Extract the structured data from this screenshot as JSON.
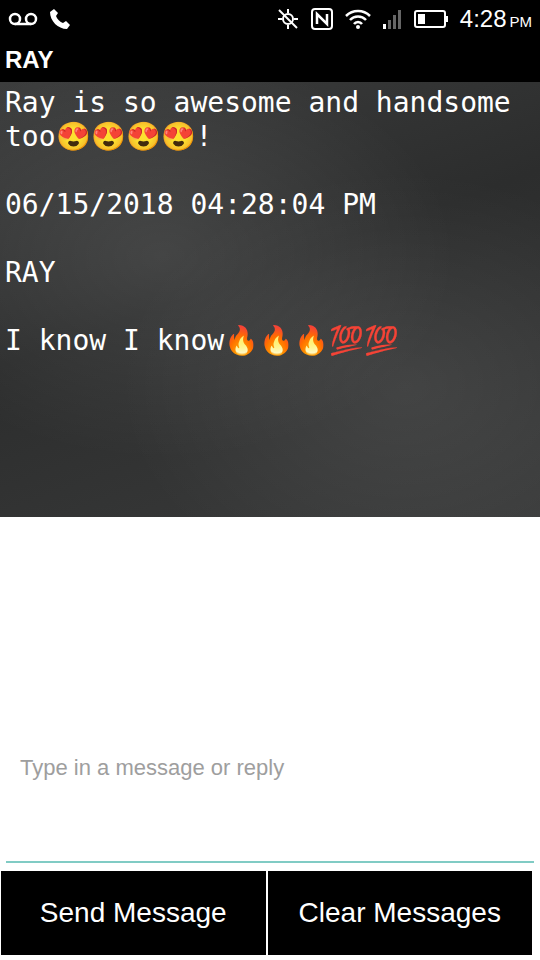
{
  "status_bar": {
    "time": "4:28",
    "ampm": "PM",
    "battery": {
      "level": 0.3
    }
  },
  "title": "RAY",
  "messages": [
    {
      "text": "Ray is so awesome and handsome too😍😍😍😍!"
    },
    {
      "text": "06/15/2018 04:28:04 PM"
    },
    {
      "text": "RAY"
    },
    {
      "text": "I know I know🔥🔥🔥💯💯"
    }
  ],
  "input": {
    "placeholder": "Type in a message or reply"
  },
  "buttons": [
    "Send Message",
    "Clear Messages"
  ]
}
